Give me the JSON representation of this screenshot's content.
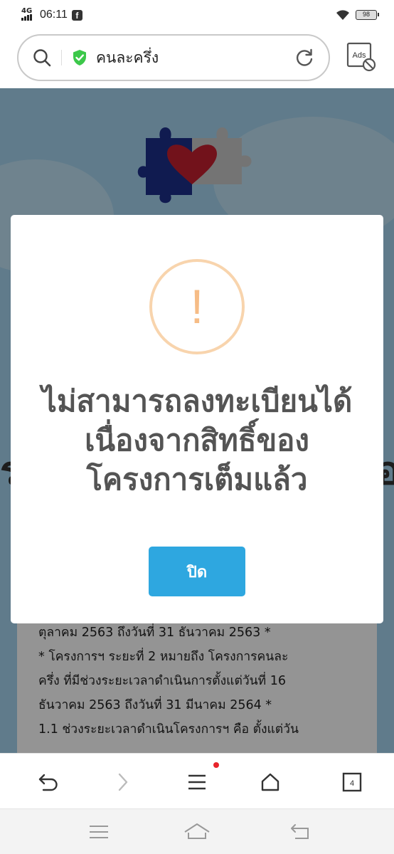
{
  "status_bar": {
    "network": "4G",
    "time": "06:11",
    "app_notification": "f",
    "battery": "98"
  },
  "address_bar": {
    "site_name": "คนละครึ่ง",
    "secure": true,
    "ads_label": "Ads"
  },
  "background_page": {
    "text_lines": [
      "ตุลาคม 2563 ถึงวันที่ 31 ธันวาคม 2563  *",
      " * โครงการฯ ระยะที่ 2 หมายถึง โครงการคนละ",
      "ครึ่ง ที่มีช่วงระยะเวลาดำเนินการตั้งแต่วันที่ 16",
      "ธันวาคม 2563 ถึงวันที่ 31 มีนาคม 2564 *",
      "1.1 ช่วงระยะเวลาดำเนินโครงการฯ คือ ตั้งแต่วัน"
    ]
  },
  "dialog": {
    "icon": "exclamation-icon",
    "title": "ไม่สามารถลงทะเบียนได้\nเนื่องจากสิทธิ์ของ\nโครงการเต็มแล้ว",
    "close_label": "ปิด",
    "accent_color": "#2ea7e0",
    "icon_color": "#f6bc86"
  },
  "browser_toolbar": {
    "tabs_count": "4",
    "items": [
      "back-icon",
      "forward-icon",
      "menu-icon",
      "home-icon",
      "tabs-icon"
    ]
  },
  "system_nav": {
    "items": [
      "recents-icon",
      "home-icon",
      "back-icon"
    ]
  }
}
